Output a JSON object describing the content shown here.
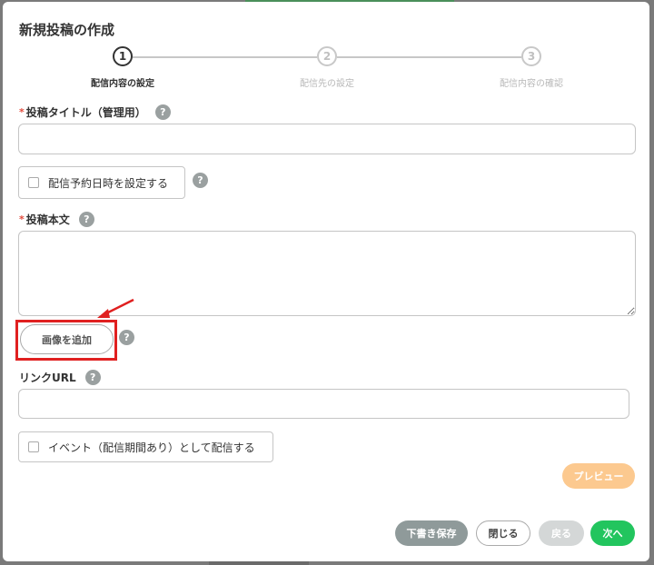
{
  "modal": {
    "title": "新規投稿の作成"
  },
  "stepper": {
    "steps": [
      {
        "number": "1",
        "label": "配信内容の設定"
      },
      {
        "number": "2",
        "label": "配信先の設定"
      },
      {
        "number": "3",
        "label": "配信内容の確認"
      }
    ],
    "active_index": 0
  },
  "form": {
    "post_title": {
      "required_mark": "*",
      "label": "投稿タイトル（管理用）",
      "value": ""
    },
    "schedule_checkbox": {
      "label": "配信予約日時を設定する",
      "checked": false
    },
    "post_body": {
      "required_mark": "*",
      "label": "投稿本文",
      "value": ""
    },
    "add_image_label": "画像を追加",
    "link_url": {
      "label": "リンクURL",
      "value": ""
    },
    "event_checkbox": {
      "label": "イベント（配信期間あり）として配信する",
      "checked": false
    },
    "help_glyph": "?"
  },
  "buttons": {
    "preview": "プレビュー",
    "save_draft": "下書き保存",
    "close": "閉じる",
    "back": "戻る",
    "next": "次へ"
  },
  "colors": {
    "accent_green": "#22c55e",
    "preview_orange": "#fcc98f",
    "draft_gray": "#8f9a9a",
    "back_disabled": "#d4d7d7",
    "required_red": "#e24a3b",
    "highlight_red": "#e02020"
  }
}
